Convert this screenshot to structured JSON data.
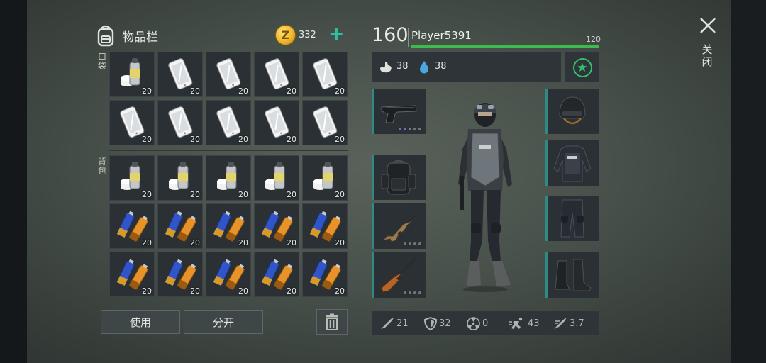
{
  "inventory": {
    "title": "物品栏",
    "pocket_label": "口袋",
    "backpack_label": "背包",
    "coins": "332",
    "coin_symbol": "Z",
    "coin_plus": "+",
    "pocket_slots": [
      {
        "item": "spray-paint-icon",
        "qty": "20"
      },
      {
        "item": "smartphone-icon",
        "qty": "20"
      },
      {
        "item": "smartphone-icon",
        "qty": "20"
      },
      {
        "item": "smartphone-icon",
        "qty": "20"
      },
      {
        "item": "smartphone-icon",
        "qty": "20"
      },
      {
        "item": "smartphone-icon",
        "qty": "20"
      },
      {
        "item": "smartphone-icon",
        "qty": "20"
      },
      {
        "item": "smartphone-icon",
        "qty": "20"
      },
      {
        "item": "smartphone-icon",
        "qty": "20"
      },
      {
        "item": "smartphone-icon",
        "qty": "20"
      }
    ],
    "backpack_slots": [
      {
        "item": "spray-paint-icon",
        "qty": "20"
      },
      {
        "item": "spray-paint-icon",
        "qty": "20"
      },
      {
        "item": "spray-paint-icon",
        "qty": "20"
      },
      {
        "item": "spray-paint-icon",
        "qty": "20"
      },
      {
        "item": "spray-paint-icon",
        "qty": "20"
      },
      {
        "item": "battery-icon",
        "qty": "20"
      },
      {
        "item": "battery-icon",
        "qty": "20"
      },
      {
        "item": "battery-icon",
        "qty": "20"
      },
      {
        "item": "battery-icon",
        "qty": "20"
      },
      {
        "item": "battery-icon",
        "qty": "20"
      },
      {
        "item": "battery-icon",
        "qty": "20"
      },
      {
        "item": "battery-icon",
        "qty": "20"
      },
      {
        "item": "battery-icon",
        "qty": "20"
      },
      {
        "item": "battery-icon",
        "qty": "20"
      },
      {
        "item": "battery-icon",
        "qty": "20"
      }
    ],
    "use_label": "使用",
    "split_label": "分开"
  },
  "character": {
    "level": "160",
    "name": "Player5391",
    "xp_max": "120",
    "xp_fraction": 1.0,
    "hunger": "38",
    "thirst": "38",
    "left_equipment": [
      "pistol-icon",
      "backpack-icon",
      "assault-rifle-icon",
      "shotgun-icon"
    ],
    "right_equipment": [
      "helmet-icon",
      "body-armor-icon",
      "pants-icon",
      "boots-icon"
    ],
    "bottom_stats": {
      "attack": "21",
      "defense": "32",
      "radiation": "0",
      "speed": "43",
      "stealth": "3.7"
    }
  },
  "close_label": "关闭",
  "colors": {
    "accent": "#2fc0a2",
    "xp_bar": "#3dbb4c",
    "slot_bg": "#2b3034"
  }
}
